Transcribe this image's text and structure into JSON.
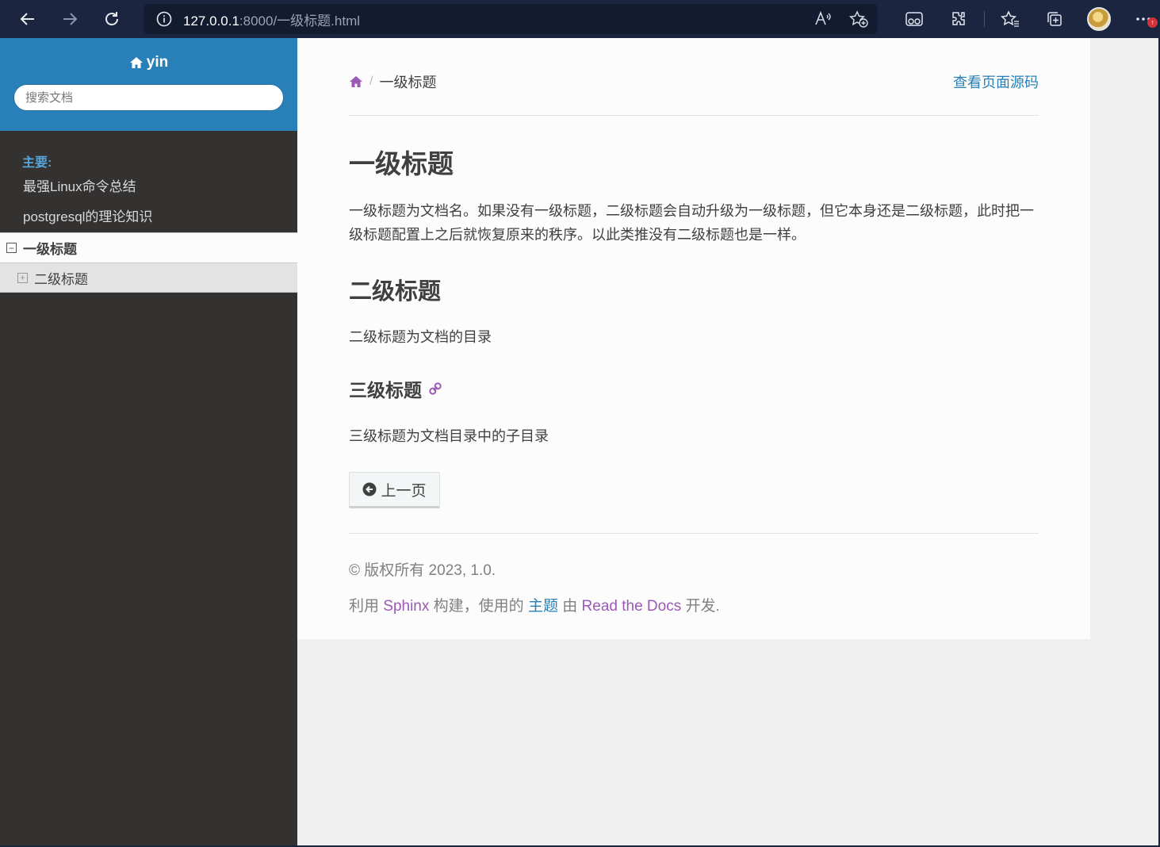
{
  "browser": {
    "url_host": "127.0.0.1",
    "url_path": ":8000/一级标题.html"
  },
  "sidebar": {
    "project_name": "yin",
    "search_placeholder": "搜索文档",
    "caption": "主要:",
    "items": [
      {
        "label": "最强Linux命令总结"
      },
      {
        "label": "postgresql的理论知识"
      }
    ],
    "current": {
      "label": "一级标题",
      "toggle": "⊟"
    },
    "sub": {
      "label": "二级标题",
      "toggle": "⊞"
    }
  },
  "content": {
    "breadcrumb_current": "一级标题",
    "breadcrumb_separator": "/",
    "view_source": "查看页面源码",
    "h1": "一级标题",
    "p1": "一级标题为文档名。如果没有一级标题，二级标题会自动升级为一级标题，但它本身还是二级标题，此时把一级标题配置上之后就恢复原来的秩序。以此类推没有二级标题也是一样。",
    "h2": "二级标题",
    "p2": "二级标题为文档的目录",
    "h3": "三级标题",
    "p3": "三级标题为文档目录中的子目录",
    "prev_button": "上一页"
  },
  "footer": {
    "copyright": "© 版权所有 2023, 1.0.",
    "built_prefix": "利用 ",
    "sphinx": "Sphinx",
    "built_mid": " 构建，使用的 ",
    "theme": "主题",
    "built_by": " 由 ",
    "rtd": "Read the Docs",
    "built_suffix": " 开发."
  },
  "colors": {
    "sidebar_bg": "#343131",
    "sidebar_header": "#2980b9",
    "link_blue": "#2980b9",
    "link_purple": "#9b59b6",
    "browser_chrome": "#1b2540"
  }
}
